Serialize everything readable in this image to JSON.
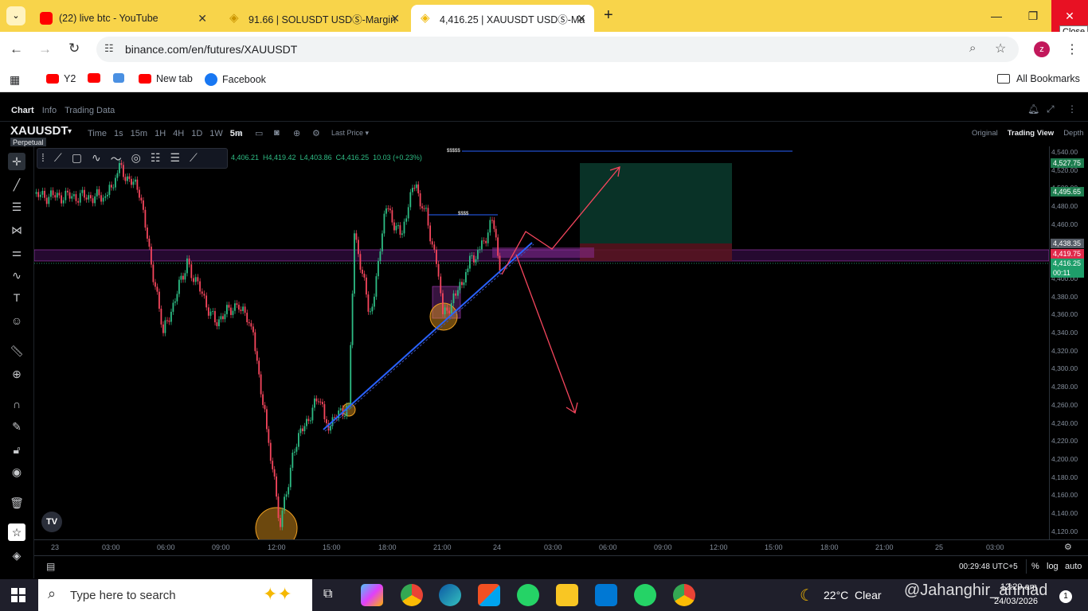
{
  "browser": {
    "tabs": [
      {
        "title": "(22) live btc - YouTube"
      },
      {
        "title": "91.66 | SOLUSDT USDⓈ-Margin"
      },
      {
        "title": "4,416.25 | XAUUSDT USDⓈ-Ma"
      }
    ],
    "new_tab": "+",
    "close_tooltip": "Close",
    "url": "binance.com/en/futures/XAUUSDT",
    "profile_initial": "z",
    "bookmarks": [
      "Y2",
      "",
      "",
      "New tab",
      "Facebook"
    ],
    "all_bookmarks": "All Bookmarks"
  },
  "binance": {
    "top_tabs": [
      "Chart",
      "Info",
      "Trading Data"
    ],
    "symbol": "XAUUSDT",
    "contract": "Perpetual",
    "intervals": [
      "Time",
      "1s",
      "15m",
      "1H",
      "4H",
      "1D",
      "1W",
      "5m"
    ],
    "price_source": "Last Price",
    "views": [
      "Original",
      "Trading View",
      "Depth"
    ],
    "ohlc": "4,406.21  H4,419.42  L4,403.86  C4,416.25  10.03 (+0.23%)",
    "level_marker": "$$$$$",
    "level_marker2": "$$$$",
    "price_axis": [
      "4,540.00",
      "4,520.00",
      "4,500.00",
      "4,480.00",
      "4,460.00",
      "4,440.00",
      "4,420.00",
      "4,400.00",
      "4,380.00",
      "4,360.00",
      "4,340.00",
      "4,320.00",
      "4,300.00",
      "4,280.00",
      "4,260.00",
      "4,240.00",
      "4,220.00",
      "4,200.00",
      "4,180.00",
      "4,160.00",
      "4,140.00",
      "4,120.00"
    ],
    "price_tags": {
      "tp": "4,527.75",
      "tp2": "4,495.65",
      "entry": "4,438.35",
      "sl": "4,419.75",
      "last": "4,416.25",
      "countdown": "00:11"
    },
    "time_axis": [
      "23",
      "03:00",
      "06:00",
      "09:00",
      "12:00",
      "15:00",
      "18:00",
      "21:00",
      "24",
      "03:00",
      "06:00",
      "09:00",
      "12:00",
      "15:00",
      "18:00",
      "21:00",
      "25",
      "03:00"
    ],
    "footer_time": "00:29:48 UTC+5",
    "footer_pct": "%",
    "footer_log": "log",
    "footer_auto": "auto",
    "colors": {
      "up": "#2ebd85",
      "down": "#f6465d",
      "trend": "#2962ff",
      "zone": "#7b2d8b"
    }
  },
  "taskbar": {
    "search_placeholder": "Type here to search",
    "weather": "22°C  Clear",
    "watermark": "@Jahanghir_ahmad",
    "time": "12:29 am",
    "date": "24/03/2026"
  }
}
